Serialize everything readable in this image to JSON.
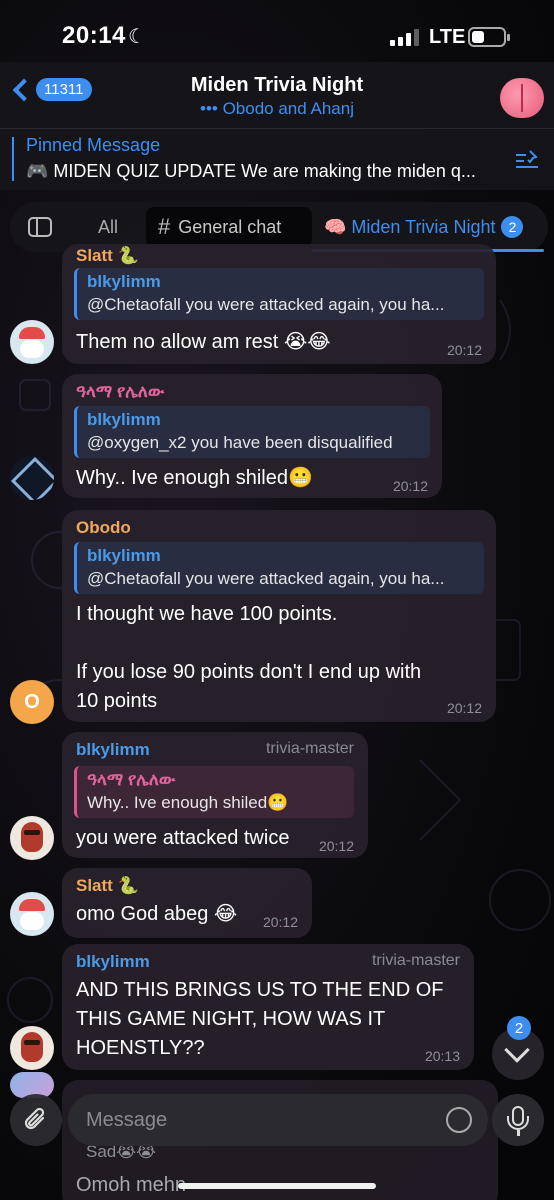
{
  "status_bar": {
    "time": "20:14",
    "network": "LTE"
  },
  "header": {
    "back_count": "11311",
    "title": "Miden Trivia Night",
    "subtitle": "Obodo and Ahanj"
  },
  "pinned": {
    "label": "Pinned Message",
    "text": "🎮 MIDEN QUIZ UPDATE We are making the miden q..."
  },
  "tabs": {
    "all": "All",
    "general": "General chat",
    "miden": "🧠 Miden Trivia Night",
    "miden_badge": "2"
  },
  "messages": [
    {
      "sender": "Slatt 🐍",
      "reply_name": "blkylimm",
      "reply_text": "@Chetaofall you were attacked again, you ha...",
      "text": "Them no allow am rest 😭😂",
      "time": "20:12"
    },
    {
      "sender": "ዓላማ የሌለው",
      "reply_name": "blkylimm",
      "reply_text": "@oxygen_x2 you have been disqualified",
      "text": "Why.. Ive enough shiled😬",
      "time": "20:12"
    },
    {
      "sender": "Obodo",
      "reply_name": "blkylimm",
      "reply_text": "@Chetaofall you were attacked again, you ha...",
      "text_lines": [
        "I thought we have 100 points.",
        "",
        "If you lose 90 points don't I end up with",
        "10 points"
      ],
      "time": "20:12",
      "avatar_letter": "O"
    },
    {
      "sender": "blkylimm",
      "role": "trivia-master",
      "reply_name": "ዓላማ የሌለው",
      "reply_text": "Why.. Ive enough shiled😬",
      "text": "you were attacked twice",
      "time": "20:12"
    },
    {
      "sender": "Slatt 🐍",
      "text": "omo God abeg 😂",
      "time": "20:12"
    },
    {
      "sender": "blkylimm",
      "role": "trivia-master",
      "text_lines": [
        "AND THIS BRINGS US TO THE END OF",
        "THIS GAME NIGHT, HOW WAS IT",
        "HOENSTLY??"
      ],
      "time": "20:13"
    }
  ],
  "partial": {
    "line1": "Sad😭😭",
    "line2": "Omoh mehn"
  },
  "scroll_badge": "2",
  "input": {
    "placeholder": "Message"
  },
  "colors": {
    "accent": "#3d8ef0",
    "obodo": "#f0a85a",
    "slatt": "#f0a85a",
    "amharic": "#e0649b",
    "blkylimm": "#4a9ae8"
  }
}
